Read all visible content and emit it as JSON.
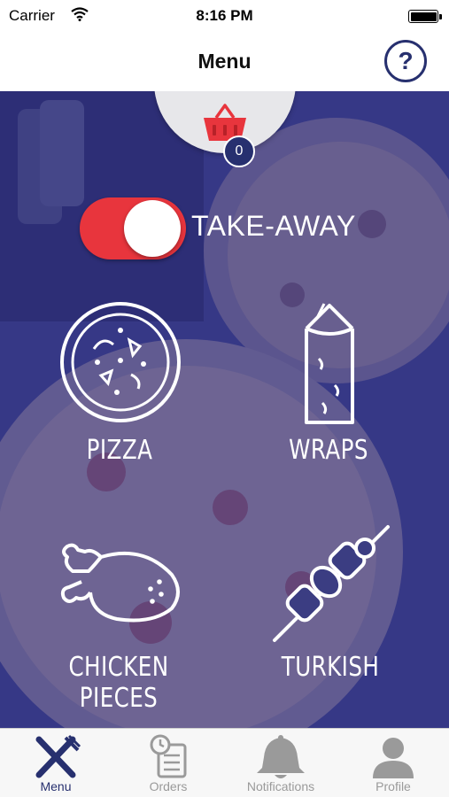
{
  "status_bar": {
    "carrier": "Carrier",
    "time": "8:16 PM"
  },
  "nav": {
    "title": "Menu",
    "help_symbol": "?"
  },
  "basket": {
    "count": "0",
    "icon": "basket-icon",
    "color": "#e8353d"
  },
  "toggle": {
    "label": "TAKE-AWAY",
    "on": true,
    "color": "#e8353d"
  },
  "categories": [
    {
      "label": "PIZZA",
      "icon": "pizza-icon"
    },
    {
      "label": "WRAPS",
      "icon": "wrap-icon"
    },
    {
      "label": "CHICKEN PIECES",
      "icon": "chicken-icon"
    },
    {
      "label": "TURKISH",
      "icon": "kebab-icon"
    }
  ],
  "tabs": [
    {
      "label": "Menu",
      "icon": "fork-knife-icon",
      "active": true
    },
    {
      "label": "Orders",
      "icon": "orders-icon",
      "active": false
    },
    {
      "label": "Notifications",
      "icon": "bell-icon",
      "active": false
    },
    {
      "label": "Profile",
      "icon": "profile-icon",
      "active": false
    }
  ],
  "colors": {
    "primary": "#27306f",
    "accent": "#e8353d",
    "overlay": "#262880"
  }
}
